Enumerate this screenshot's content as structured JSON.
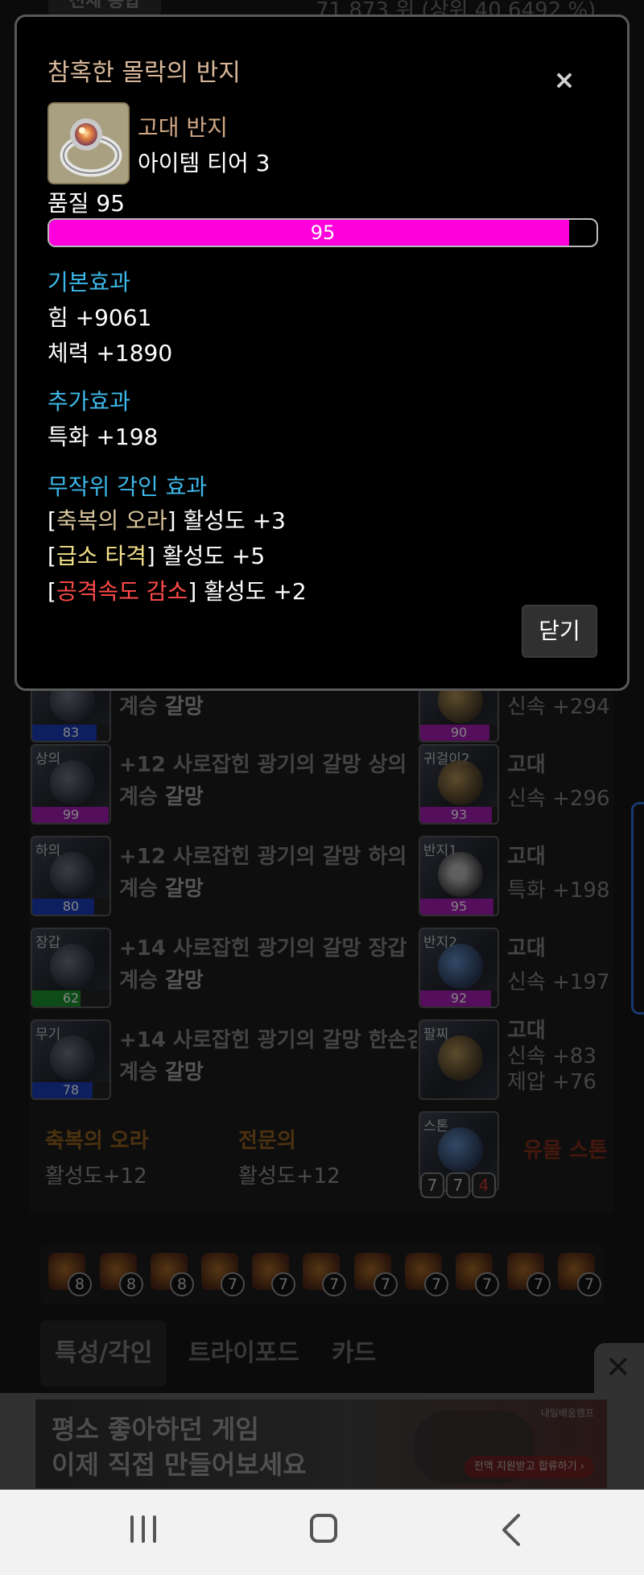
{
  "background": {
    "top_tab": "전체 통합",
    "top_stat": "71,873 위 (상위 40.6492 %)",
    "equipment_left": [
      {
        "slot": "",
        "quality": "83",
        "name_line1": "",
        "name_line2_prefix": "계승 ",
        "name_line2_set": "갈망",
        "q_color": "#1a3ab0"
      },
      {
        "slot": "상의",
        "quality": "99",
        "name_line1": "+12 사로잡힌 광기의 갈망 상의",
        "name_line2_prefix": "계승 ",
        "name_line2_set": "갈망",
        "q_color": "#9a1aa8"
      },
      {
        "slot": "하의",
        "quality": "80",
        "name_line1": "+12 사로잡힌 광기의 갈망 하의",
        "name_line2_prefix": "계승 ",
        "name_line2_set": "갈망",
        "q_color": "#1a3ab0"
      },
      {
        "slot": "장갑",
        "quality": "62",
        "name_line1": "+14 사로잡힌 광기의 갈망 장갑",
        "name_line2_prefix": "계승 ",
        "name_line2_set": "갈망",
        "q_color": "#1a8a2a"
      },
      {
        "slot": "무기",
        "quality": "78",
        "name_line1": "+14 사로잡힌 광기의 갈망 한손검",
        "name_line2_prefix": "계승 ",
        "name_line2_set": "갈망",
        "q_color": "#1a3ab0"
      }
    ],
    "accessories_right": [
      {
        "slot": "",
        "quality": "90",
        "grade": "",
        "stat": "신속 +294"
      },
      {
        "slot": "귀걸이2",
        "quality": "93",
        "grade": "고대",
        "stat": "신속 +296"
      },
      {
        "slot": "반지1",
        "quality": "95",
        "grade": "고대",
        "stat": "특화 +198"
      },
      {
        "slot": "반지2",
        "quality": "92",
        "grade": "고대",
        "stat": "신속 +197"
      },
      {
        "slot": "팔찌",
        "quality": "",
        "grade": "고대",
        "stat": "신속 +83",
        "stat2": "제압 +76"
      }
    ],
    "set_effects": [
      {
        "name": "축복의 오라",
        "value": "활성도+12"
      },
      {
        "name": "전문의",
        "value": "활성도+12"
      }
    ],
    "stone": {
      "slot": "스톤",
      "label": "유물 스톤",
      "levels": [
        "7",
        "7",
        "4"
      ]
    },
    "gems": [
      "8",
      "8",
      "8",
      "7",
      "7",
      "7",
      "7",
      "7",
      "7",
      "7",
      "7"
    ],
    "bottom_tabs": [
      "특성/각인",
      "트라이포드",
      "카드"
    ]
  },
  "ad": {
    "line1": "평소 좋아하던 게임",
    "line2": "이제 직접 만들어보세요",
    "brand": "내일배움캠프",
    "cta": "전액 지원받고 합류하기 ›"
  },
  "modal": {
    "title": "참혹한 몰락의 반지",
    "close_icon": "×",
    "item_grade": "고대 반지",
    "item_tier": "아이템 티어 3",
    "quality_label": "품질 95",
    "quality_value": 95,
    "quality_text": "95",
    "quality_color": "#ff00dc",
    "sections": {
      "base_title": "기본효과",
      "base_stats": [
        "힘 +9061",
        "체력 +1890"
      ],
      "extra_title": "추가효과",
      "extra_stats": [
        "특화 +198"
      ],
      "engraving_title": "무작위 각인 효과",
      "engravings": [
        {
          "name": "축복의 오라",
          "effect": "활성도 +3"
        },
        {
          "name": "급소 타격",
          "effect": "활성도 +5"
        },
        {
          "name": "공격속도 감소",
          "effect": "활성도 +2"
        }
      ]
    },
    "close_button": "닫기"
  }
}
